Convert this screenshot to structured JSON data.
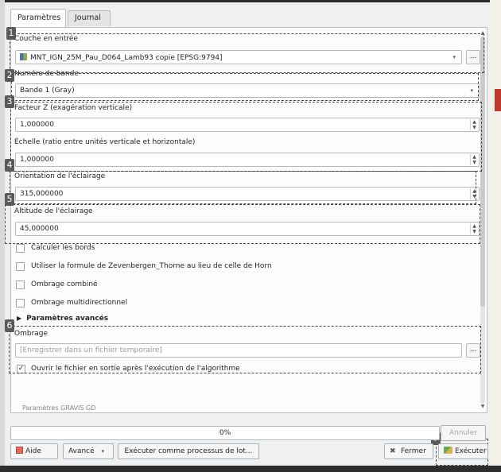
{
  "tabs": [
    {
      "label": "Paramètres"
    },
    {
      "label": "Journal"
    }
  ],
  "params": {
    "input_layer": {
      "label": "Couche en entrée",
      "value": "MNT_IGN_25M_Pau_D064_Lamb93 copie [EPSG:9794]",
      "browse": "..."
    },
    "band": {
      "label": "Numéro de bande",
      "value": "Bande 1 (Gray)"
    },
    "z_factor": {
      "label": "Facteur Z (exagération verticale)",
      "value": "1,000000"
    },
    "scale": {
      "label": "Échelle (ratio entre unités verticale et horizontale)",
      "value": "1,000000"
    },
    "azimuth": {
      "label": "Orientation de l'éclairage",
      "value": "315,000000"
    },
    "altitude": {
      "label": "Altitude de l'éclairage",
      "value": "45,000000"
    }
  },
  "checkboxes": [
    {
      "label": "Calculer les bords",
      "checked": false
    },
    {
      "label": "Utiliser la formule de Zevenbergen_Thorne au lieu de celle de Horn",
      "checked": false
    },
    {
      "label": "Ombrage combiné",
      "checked": false
    },
    {
      "label": "Ombrage multidirectionnel",
      "checked": false
    }
  ],
  "advanced": {
    "label": "Paramètres avancés"
  },
  "output": {
    "label": "Ombrage",
    "placeholder": "[Enregistrer dans un fichier temporaire]",
    "browse": "...",
    "open_after": {
      "label": "Ouvrir le fichier en sortie après l'exécution de l'algorithme",
      "checked": true
    }
  },
  "badges": [
    "1",
    "2",
    "3",
    "4",
    "5",
    "6",
    "7"
  ],
  "cut_text": "Paramètres GRAVIS GD",
  "progress": {
    "value": 0,
    "text": "0%"
  },
  "buttons": {
    "cancel": "Annuler",
    "help": "Aide",
    "advanced": "Avancé",
    "batch": "Exécuter comme processus de lot...",
    "close": "Fermer",
    "run": "Exécuter"
  },
  "icons": {
    "combo_arrow": "▾",
    "dropdown": "▾",
    "spin_up": "▲",
    "spin_down": "▼",
    "expander": "▶",
    "check": "✓",
    "close_x": "✖"
  }
}
